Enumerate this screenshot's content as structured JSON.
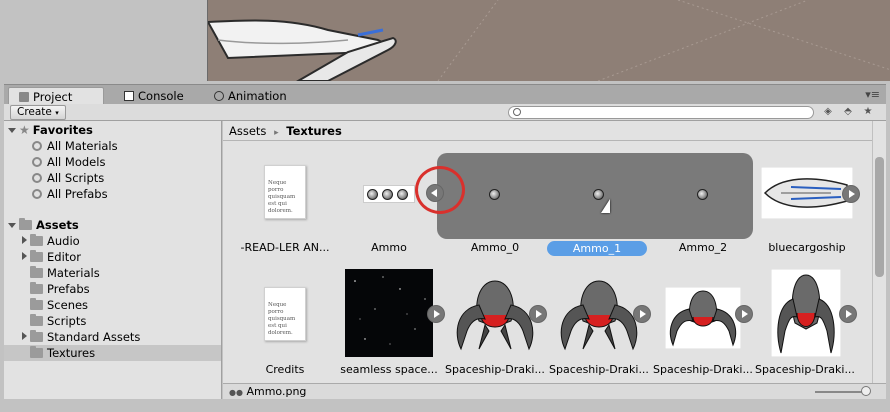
{
  "tabs": [
    {
      "label": "Project",
      "icon": "folder-icon",
      "active": true
    },
    {
      "label": "Console",
      "icon": "console-icon",
      "active": false
    },
    {
      "label": "Animation",
      "icon": "clock-icon",
      "active": false
    }
  ],
  "toolbar": {
    "create_label": "Create",
    "search_value": ""
  },
  "sidebar": {
    "favorites_label": "Favorites",
    "favorites": [
      "All Materials",
      "All Models",
      "All Scripts",
      "All Prefabs"
    ],
    "assets_label": "Assets",
    "folders": [
      {
        "label": "Audio",
        "expandable": true
      },
      {
        "label": "Editor",
        "expandable": true
      },
      {
        "label": "Materials",
        "expandable": false
      },
      {
        "label": "Prefabs",
        "expandable": false
      },
      {
        "label": "Scenes",
        "expandable": false
      },
      {
        "label": "Scripts",
        "expandable": false
      },
      {
        "label": "Standard Assets",
        "expandable": true
      },
      {
        "label": "Textures",
        "expandable": false,
        "selected": true
      }
    ]
  },
  "breadcrumb": {
    "root": "Assets",
    "separator": "▸",
    "current": "Textures"
  },
  "assets_row1": [
    {
      "label": "-READ-LER AN...",
      "doc_text": "Neque porro quisquam est qui dolorem."
    },
    {
      "label": "Ammo"
    },
    {
      "label": "Ammo_0"
    },
    {
      "label": "Ammo_1",
      "selected": true
    },
    {
      "label": "Ammo_2"
    },
    {
      "label": "bluecargoship"
    }
  ],
  "assets_row2": [
    {
      "label": "Credits",
      "doc_text": "Neque porro quisquam est qui dolorem."
    },
    {
      "label": "seamless space..."
    },
    {
      "label": "Spaceship-Draki..."
    },
    {
      "label": "Spaceship-Draki..."
    },
    {
      "label": "Spaceship-Draki..."
    },
    {
      "label": "Spaceship-Draki..."
    }
  ],
  "status": {
    "file": "Ammo.png"
  },
  "colors": {
    "selection": "#5b9ee6",
    "expanded_panel": "#7a7a7a",
    "highlight_ring": "#d9302c"
  }
}
